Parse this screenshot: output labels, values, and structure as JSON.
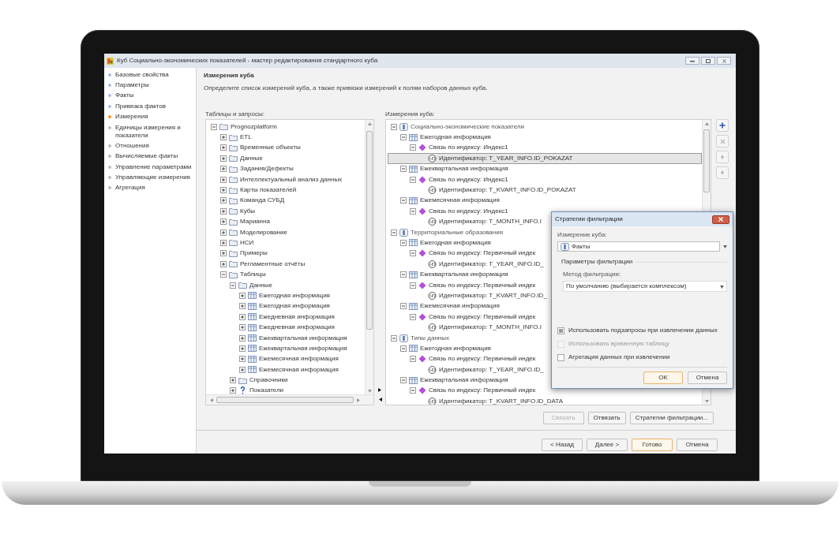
{
  "window": {
    "title": "Куб Социально-экономических показателей - мастер редактирования стандартного куба"
  },
  "steps": [
    {
      "label": "Базовые свойства",
      "color": "#a9bcdc"
    },
    {
      "label": "Параметры",
      "color": "#a9bcdc"
    },
    {
      "label": "Факты",
      "color": "#a9bcdc"
    },
    {
      "label": "Привязка фактов",
      "color": "#a9bcdc"
    },
    {
      "label": "Измерения",
      "color": "#f39a2b"
    },
    {
      "label": "Единицы измерения и показатели",
      "color": "#bdbdbd"
    },
    {
      "label": "Отношения",
      "color": "#bdbdbd"
    },
    {
      "label": "Вычисляемые факты",
      "color": "#bdbdbd"
    },
    {
      "label": "Управление параметрами",
      "color": "#bdbdbd"
    },
    {
      "label": "Управляющие измерения",
      "color": "#bdbdbd"
    },
    {
      "label": "Агрегация",
      "color": "#bdbdbd"
    }
  ],
  "page": {
    "title": "Измерения куба",
    "description": "Определите список измерений куба, а также привязки измерений к полям наборов данных куба."
  },
  "sources": {
    "label": "Таблицы и запросы:",
    "tree": [
      {
        "label": "Prognozplatform",
        "kind": "folder",
        "expanded": true,
        "children": [
          {
            "label": "ETL",
            "kind": "folder",
            "expanded": false
          },
          {
            "label": "Временные объекты",
            "kind": "folder",
            "expanded": false
          },
          {
            "label": "Данные",
            "kind": "folder",
            "expanded": false
          },
          {
            "label": "Задания/Дефекты",
            "kind": "folder",
            "expanded": false
          },
          {
            "label": "Интеллектуальный анализ данных",
            "kind": "folder",
            "expanded": false
          },
          {
            "label": "Карты показателей",
            "kind": "folder",
            "expanded": false
          },
          {
            "label": "Команда СУБД",
            "kind": "folder",
            "expanded": false
          },
          {
            "label": "Кубы",
            "kind": "folder",
            "expanded": false
          },
          {
            "label": "Марианна",
            "kind": "folder",
            "expanded": false
          },
          {
            "label": "Моделирование",
            "kind": "folder",
            "expanded": false
          },
          {
            "label": "НСИ",
            "kind": "folder",
            "expanded": false
          },
          {
            "label": "Примеры",
            "kind": "folder",
            "expanded": false
          },
          {
            "label": "Регламентные отчёты",
            "kind": "folder",
            "expanded": false
          },
          {
            "label": "Таблицы",
            "kind": "folder",
            "expanded": true,
            "children": [
              {
                "label": "Данные",
                "kind": "folder",
                "expanded": true,
                "children": [
                  {
                    "label": "Ежегодная информация",
                    "kind": "table",
                    "expanded": false
                  },
                  {
                    "label": "Ежегодная информация",
                    "kind": "table",
                    "expanded": false
                  },
                  {
                    "label": "Ежедневная информация",
                    "kind": "table",
                    "expanded": false
                  },
                  {
                    "label": "Ежедневная информация",
                    "kind": "table",
                    "expanded": false
                  },
                  {
                    "label": "Ежеквартальная информация",
                    "kind": "table",
                    "expanded": false
                  },
                  {
                    "label": "Ежеквартальная информация",
                    "kind": "table",
                    "expanded": false
                  },
                  {
                    "label": "Ежемесячная информация",
                    "kind": "table",
                    "expanded": false
                  },
                  {
                    "label": "Ежемесячная информация",
                    "kind": "table",
                    "expanded": false
                  }
                ]
              },
              {
                "label": "Справочники",
                "kind": "folder",
                "expanded": false
              },
              {
                "label": "Показатели",
                "kind": "query",
                "expanded": false
              }
            ]
          }
        ]
      }
    ]
  },
  "dimensions": {
    "label": "Измерения куба:",
    "tree": [
      {
        "label": "Социально-экономические показатели",
        "kind": "dimension",
        "expanded": true,
        "selected": false,
        "children": [
          {
            "label": "Ежегодная информация",
            "kind": "table",
            "expanded": true,
            "selected": false,
            "children": [
              {
                "label": "Связь по индексу: Индекс1",
                "kind": "link",
                "expanded": true,
                "selected": false,
                "children": [
                  {
                    "label": "Идентификатор: T_YEAR_INFO.ID_POKAZAT",
                    "kind": "attribute",
                    "selected": true
                  }
                ]
              }
            ]
          },
          {
            "label": "Ежеквартальная информация",
            "kind": "table",
            "expanded": true,
            "selected": false,
            "children": [
              {
                "label": "Связь по индексу: Индекс1",
                "kind": "link",
                "expanded": true,
                "selected": false,
                "children": [
                  {
                    "label": "Идентификатор: T_KVART_INFO.ID_POKAZAT",
                    "kind": "attribute",
                    "selected": false
                  }
                ]
              }
            ]
          },
          {
            "label": "Ежемесячная информация",
            "kind": "table",
            "expanded": true,
            "selected": false,
            "children": [
              {
                "label": "Связь по индексу: Индекс1",
                "kind": "link",
                "expanded": true,
                "selected": false,
                "children": [
                  {
                    "label": "Идентификатор: T_MONTH_INFO.I",
                    "kind": "attribute",
                    "selected": false
                  }
                ]
              }
            ]
          }
        ]
      },
      {
        "label": "Территориальные образования",
        "kind": "dimension",
        "expanded": true,
        "selected": false,
        "children": [
          {
            "label": "Ежегодная информация",
            "kind": "table",
            "expanded": true,
            "selected": false,
            "children": [
              {
                "label": "Связь по индексу: Первичный индек",
                "kind": "link",
                "expanded": true,
                "selected": false,
                "children": [
                  {
                    "label": "Идентификатор: T_YEAR_INFO.ID_",
                    "kind": "attribute",
                    "selected": false
                  }
                ]
              }
            ]
          },
          {
            "label": "Ежеквартальная информация",
            "kind": "table",
            "expanded": true,
            "selected": false,
            "children": [
              {
                "label": "Связь по индексу: Первичный индек",
                "kind": "link",
                "expanded": true,
                "selected": false,
                "children": [
                  {
                    "label": "Идентификатор: T_KVART_INFO.ID_",
                    "kind": "attribute",
                    "selected": false
                  }
                ]
              }
            ]
          },
          {
            "label": "Ежемесячная информация",
            "kind": "table",
            "expanded": true,
            "selected": false,
            "children": [
              {
                "label": "Связь по индексу: Первичный индек",
                "kind": "link",
                "expanded": true,
                "selected": false,
                "children": [
                  {
                    "label": "Идентификатор: T_MONTH_INFO.I",
                    "kind": "attribute",
                    "selected": false
                  }
                ]
              }
            ]
          }
        ]
      },
      {
        "label": "Типы данных",
        "kind": "dimension",
        "expanded": true,
        "selected": false,
        "children": [
          {
            "label": "Ежегодная информация",
            "kind": "table",
            "expanded": true,
            "selected": false,
            "children": [
              {
                "label": "Связь по индексу: Первичный индек",
                "kind": "link",
                "expanded": true,
                "selected": false,
                "children": [
                  {
                    "label": "Идентификатор: T_YEAR_INFO.ID_",
                    "kind": "attribute",
                    "selected": false
                  }
                ]
              }
            ]
          },
          {
            "label": "Ежеквартальная информация",
            "kind": "table",
            "expanded": true,
            "selected": false,
            "children": [
              {
                "label": "Связь по индексу: Первичный индек",
                "kind": "link",
                "expanded": true,
                "selected": false,
                "children": [
                  {
                    "label": "Идентификатор: T_KVART_INFO.ID_DATA",
                    "kind": "attribute",
                    "selected": false
                  }
                ]
              }
            ]
          }
        ]
      }
    ]
  },
  "tool_buttons": [
    {
      "kind": "add",
      "disabled": false
    },
    {
      "kind": "remove",
      "disabled": true
    },
    {
      "kind": "move_up",
      "disabled": true
    },
    {
      "kind": "move_down",
      "disabled": true
    }
  ],
  "binding_buttons": [
    {
      "label": "Связать",
      "disabled": true
    },
    {
      "label": "Отвязать",
      "disabled": false
    },
    {
      "label": "Стратегии фильтрации...",
      "disabled": false
    }
  ],
  "nav_buttons": [
    {
      "label": "< Назад",
      "default": false
    },
    {
      "label": "Далее >",
      "default": false
    },
    {
      "label": "Готово",
      "default": true
    },
    {
      "label": "Отмена",
      "default": false
    }
  ],
  "dialog": {
    "title": "Стратегии фильтрации",
    "dimension": {
      "label": "Измерение куба:",
      "value": "Факты"
    },
    "group": "Параметры фильтрации",
    "method": {
      "label": "Метод фильтрации:",
      "value": "По умолчанию (выбирается комплексом)"
    },
    "options": [
      {
        "label": "Использовать подзапросы при извлечении данных",
        "checked": true,
        "disabled": false
      },
      {
        "label": "Использовать временную таблицу",
        "checked": false,
        "disabled": true
      },
      {
        "label": "Агрегация данных при извлечении",
        "checked": false,
        "disabled": false
      }
    ],
    "buttons": [
      {
        "label": "OK",
        "default": true
      },
      {
        "label": "Отмена",
        "default": false
      }
    ]
  }
}
